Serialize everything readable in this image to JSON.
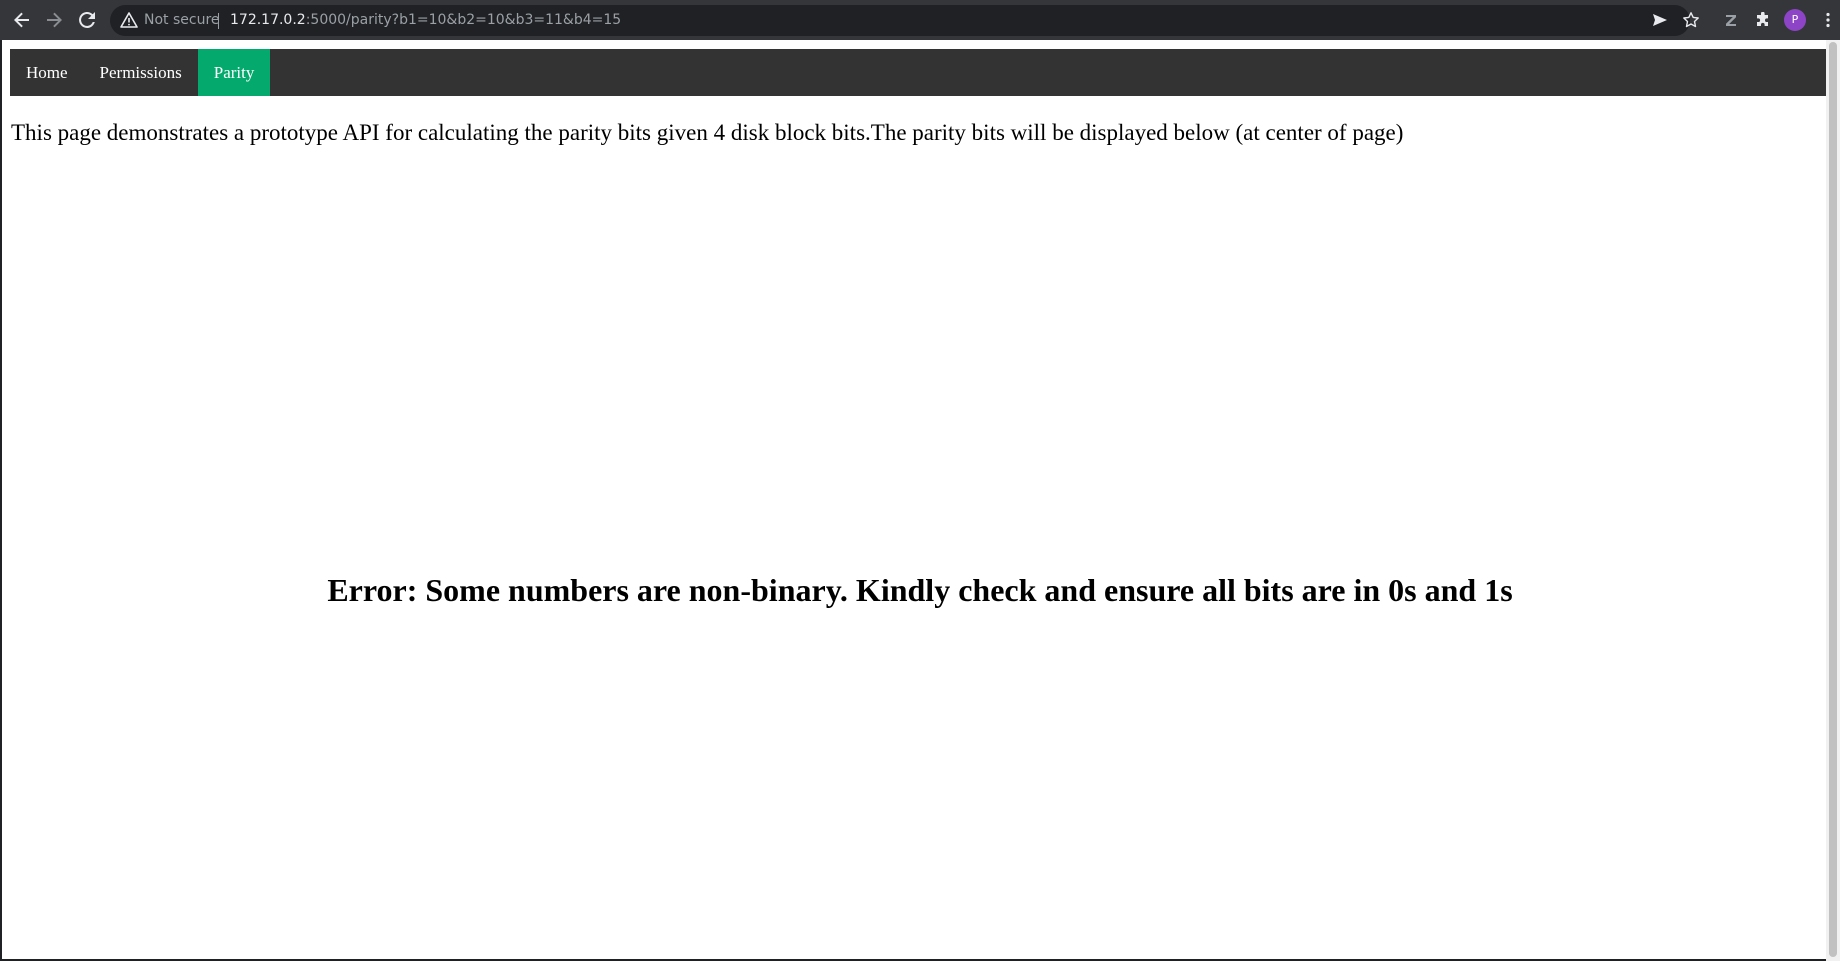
{
  "browser": {
    "security_label": "Not secure",
    "url_host": "172.17.0.2",
    "url_rest": ":5000/parity?b1=10&b2=10&b3=11&b4=15",
    "profile_initial": "P",
    "icons": [
      "back-icon",
      "forward-icon",
      "reload-icon",
      "warning-icon",
      "send-icon",
      "star-icon",
      "extension-z-icon",
      "puzzle-icon",
      "kebab-menu-icon"
    ]
  },
  "nav": {
    "items": [
      {
        "label": "Home",
        "active": false
      },
      {
        "label": "Permissions",
        "active": false
      },
      {
        "label": "Parity",
        "active": true
      }
    ],
    "active_color": "#04aa6d",
    "bar_color": "#333333"
  },
  "page": {
    "intro": "This page demonstrates a prototype API for calculating the parity bits given 4 disk block bits.The parity bits will be displayed below (at center of page)",
    "result": "Error: Some numbers are non-binary. Kindly check and ensure all bits are in 0s and 1s"
  }
}
